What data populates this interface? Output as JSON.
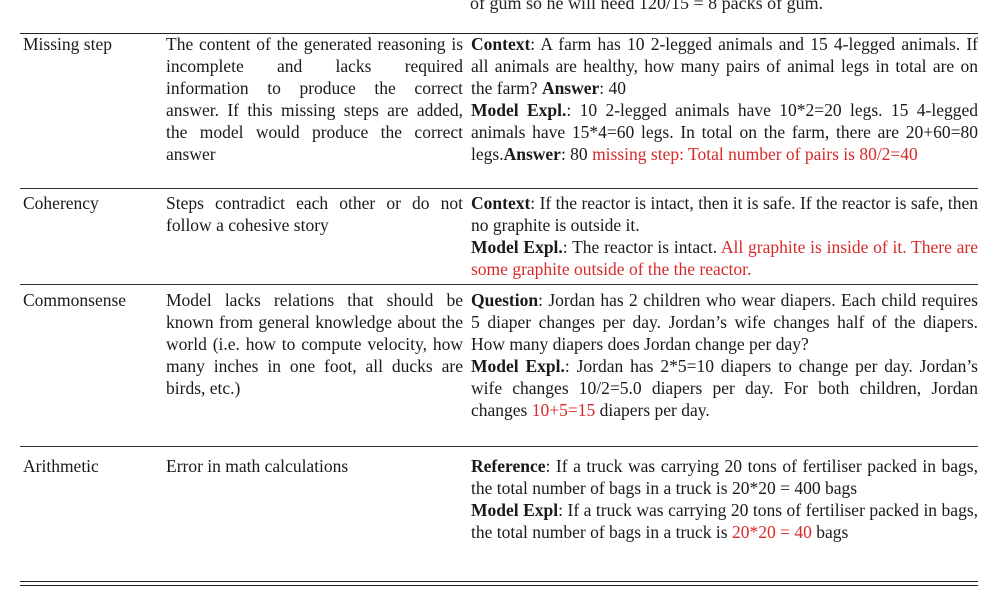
{
  "cut_text": "of gum so he will need 120/15 = 8 packs of gum.",
  "rows": [
    {
      "category": "Missing step",
      "definition": "The content of the generated reasoning is incomplete and lacks required information to produce the correct answer. If this missing steps are added, the model would produce the correct answer",
      "example": {
        "context_label": "Context",
        "context": ": A farm has 10 2-legged animals and 15 4-legged animals. If all animals are healthy, how many pairs of animal legs in total are on the farm?",
        "answer_label": "Answer",
        "answer": ": 40",
        "expl_label": "Model Expl.",
        "expl": ": 10 2-legged animals have 10*2=20 legs. 15 4-legged animals have 15*4=60 legs. In total on the farm, there are 20+60=80 legs.",
        "expl_answer_label": "Answer",
        "expl_answer": ": 80",
        "error": "missing step: Total number of pairs is 80/2=40"
      }
    },
    {
      "category": "Coherency",
      "definition": "Steps contradict each other or do not follow a cohesive story",
      "example": {
        "context_label": "Context",
        "context": ": If the reactor is intact, then it is safe. If the reactor is safe, then no graphite is outside it.",
        "expl_label": "Model Expl.",
        "expl": ": The reactor is intact.",
        "error": "All graphite is inside of it. There are some graphite outside of the the reactor."
      }
    },
    {
      "category": "Commonsense",
      "definition": "Model lacks relations that should be known from general knowledge about the world (i.e. how to compute velocity, how many inches in one foot, all ducks are birds, etc.)",
      "example": {
        "question_label": "Question",
        "question": ": Jordan has 2 children who wear diapers. Each child requires 5 diaper changes per day. Jordan’s wife changes half of the diapers. How many diapers does Jordan change per day?",
        "expl_label": "Model Expl.",
        "expl": ": Jordan has 2*5=10 diapers to change per day. Jordan’s wife changes 10/2=5.0 diapers per day. For both children, Jordan changes",
        "error": "10+5=15",
        "tail": " diapers per day."
      }
    },
    {
      "category": "Arithmetic",
      "definition": "Error in math calculations",
      "example": {
        "reference_label": "Reference",
        "reference": ": If a truck was carrying 20 tons of fertiliser packed in bags, the total number of bags in a truck is 20*20 = 400 bags",
        "expl_label": "Model Expl",
        "expl": ": If a truck was carrying 20 tons of fertiliser packed in bags, the total number of bags in a truck is",
        "error": "20*20 = 40",
        "tail": " bags"
      }
    }
  ]
}
